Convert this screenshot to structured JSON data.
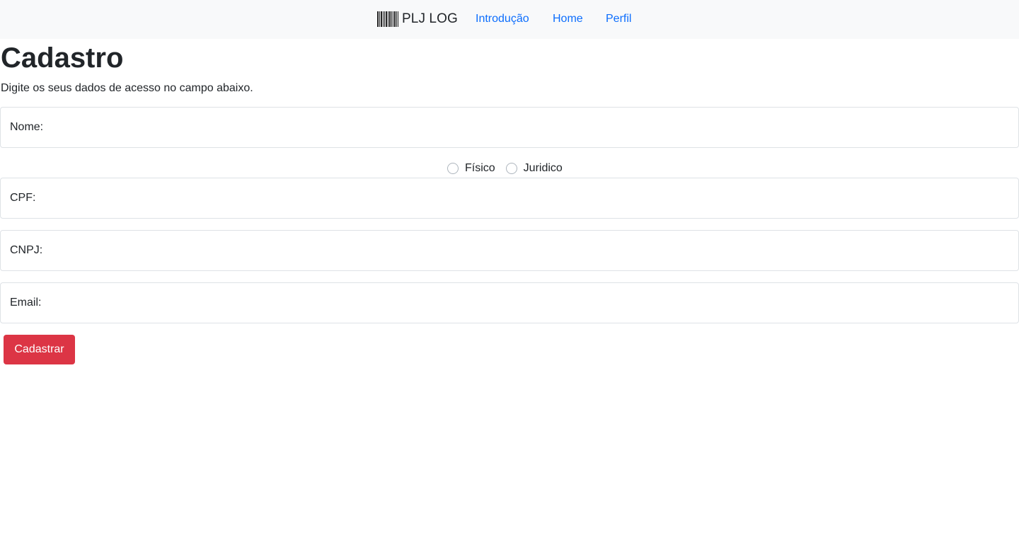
{
  "navbar": {
    "brand_icon": "barcode-icon",
    "brand_text": "PLJ LOG",
    "links": [
      {
        "label": "Introdução"
      },
      {
        "label": "Home"
      },
      {
        "label": "Perfil"
      }
    ]
  },
  "page": {
    "title": "Cadastro",
    "subtitle": "Digite os seus dados de acesso no campo abaixo."
  },
  "form": {
    "nome_placeholder": "Nome:",
    "person_type_options": [
      {
        "label": "Físico",
        "selected": false
      },
      {
        "label": "Juridico",
        "selected": false
      }
    ],
    "cpf_placeholder": "CPF:",
    "cnpj_placeholder": "CNPJ:",
    "email_placeholder": "Email:",
    "submit_label": "Cadastrar"
  },
  "colors": {
    "navbar_bg": "#f8f9fa",
    "link": "#0d6efd",
    "submit_bg": "#dc3545",
    "text": "#212529"
  }
}
